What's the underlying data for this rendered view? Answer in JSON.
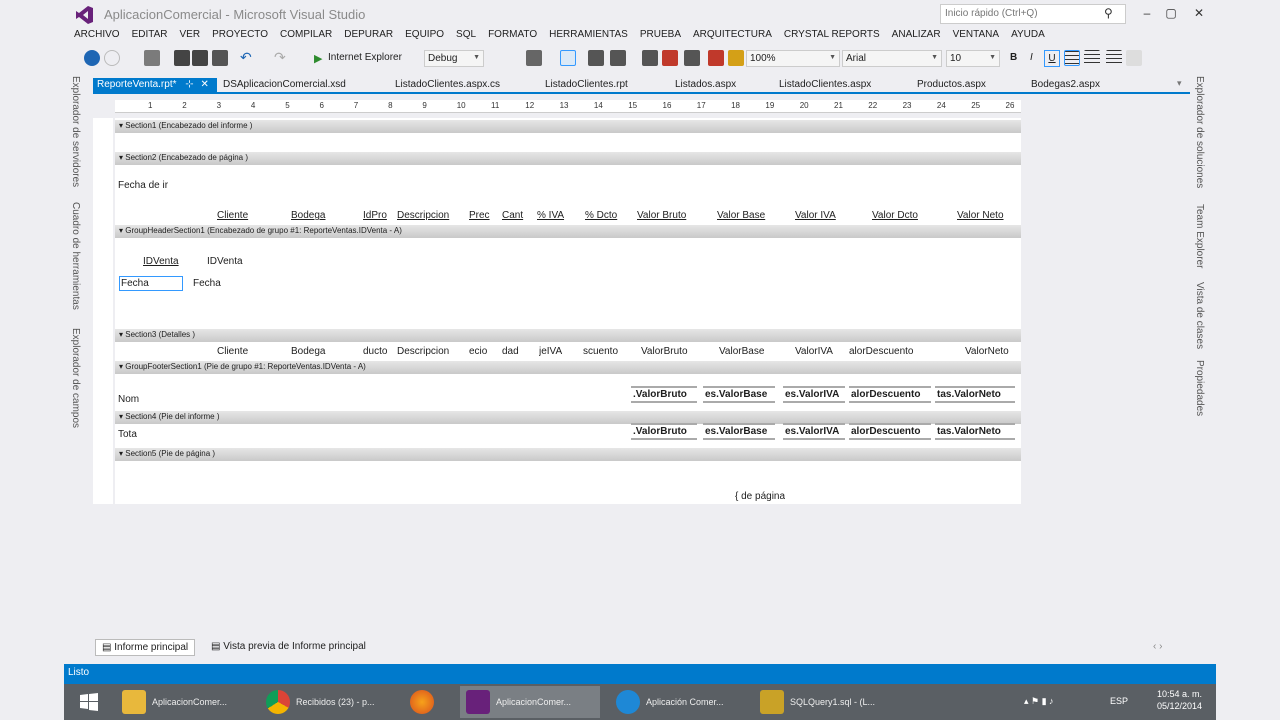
{
  "window": {
    "title": "AplicacionComercial - Microsoft Visual Studio",
    "quick_launch_placeholder": "Inicio rápido (Ctrl+Q)",
    "min": "–",
    "max": "▢",
    "close": "✕"
  },
  "menu": [
    "ARCHIVO",
    "EDITAR",
    "VER",
    "PROYECTO",
    "COMPILAR",
    "DEPURAR",
    "EQUIPO",
    "SQL",
    "FORMATO",
    "HERRAMIENTAS",
    "PRUEBA",
    "ARQUITECTURA",
    "CRYSTAL REPORTS",
    "ANALIZAR",
    "VENTANA",
    "AYUDA"
  ],
  "toolbar": {
    "browser": "Internet Explorer",
    "config": "Debug",
    "zoom": "100%",
    "font": "Arial",
    "size": "10",
    "bold": "B",
    "italic": "I",
    "underline": "U"
  },
  "tabs": [
    "ReporteVenta.rpt*",
    "DSAplicacionComercial.xsd",
    "ListadoClientes.aspx.cs",
    "ListadoClientes.rpt",
    "Listados.aspx",
    "ListadoClientes.aspx",
    "Productos.aspx",
    "Bodegas2.aspx"
  ],
  "left_panels": [
    "Explorador de servidores",
    "Cuadro de herramientas",
    "Explorador de campos"
  ],
  "right_panels": [
    "Explorador de soluciones",
    "Team Explorer",
    "Vista de clases",
    "Propiedades"
  ],
  "ruler": [
    "1",
    "2",
    "3",
    "4",
    "5",
    "6",
    "7",
    "8",
    "9",
    "10",
    "11",
    "12",
    "13",
    "14",
    "15",
    "16",
    "17",
    "18",
    "19",
    "20",
    "21",
    "22",
    "23",
    "24",
    "25",
    "26"
  ],
  "sections": {
    "s1": "Section1 (Encabezado del informe )",
    "s2": "Section2 (Encabezado de página )",
    "gh": "GroupHeaderSection1 (Encabezado de grupo #1: ReporteVentas.IDVenta - A)",
    "s3": "Section3 (Detalles )",
    "gf": "GroupFooterSection1 (Pie de grupo #1: ReporteVentas.IDVenta - A)",
    "s4": "Section4 (Pie del informe )",
    "s5": "Section5 (Pie de página )"
  },
  "page_header": {
    "date": "Fecha de ir",
    "cols": [
      "Cliente",
      "Bodega",
      "IdPro",
      "Descripcion",
      "Prec",
      "Cant",
      "% IVA",
      "% Dcto",
      "Valor Bruto",
      "Valor Base",
      "Valor IVA",
      "Valor Dcto",
      "Valor Neto"
    ]
  },
  "group_header": {
    "id_label": "IDVenta",
    "id_value": "IDVenta",
    "date_label": "Fecha",
    "date_value": "Fecha"
  },
  "details": [
    "Cliente",
    "Bodega",
    "ducto",
    "Descripcion",
    "ecio",
    "dad",
    "jeIVA",
    "scuento",
    "ValorBruto",
    "ValorBase",
    "ValorIVA",
    "alorDescuento",
    "ValorNeto"
  ],
  "group_footer": {
    "label": "Nom",
    "totals": [
      ".ValorBruto",
      "es.ValorBase",
      "es.ValorIVA",
      "alorDescuento",
      "tas.ValorNeto"
    ]
  },
  "report_footer": {
    "label": "Tota",
    "totals": [
      ".ValorBruto",
      "es.ValorBase",
      "es.ValorIVA",
      "alorDescuento",
      "tas.ValorNeto"
    ]
  },
  "page_footer": {
    "page": "{ de página"
  },
  "bottom_tabs": [
    "Informe principal",
    "Vista previa de Informe principal"
  ],
  "status": "Listo",
  "taskbar": [
    "AplicacionComer...",
    "Recibidos (23) - p...",
    "",
    "",
    "Aplicación Comer...",
    "SQLQuery1.sql - (L..."
  ],
  "clock": {
    "time": "10:54 a. m.",
    "date": "05/12/2014",
    "lang": "ESP"
  }
}
